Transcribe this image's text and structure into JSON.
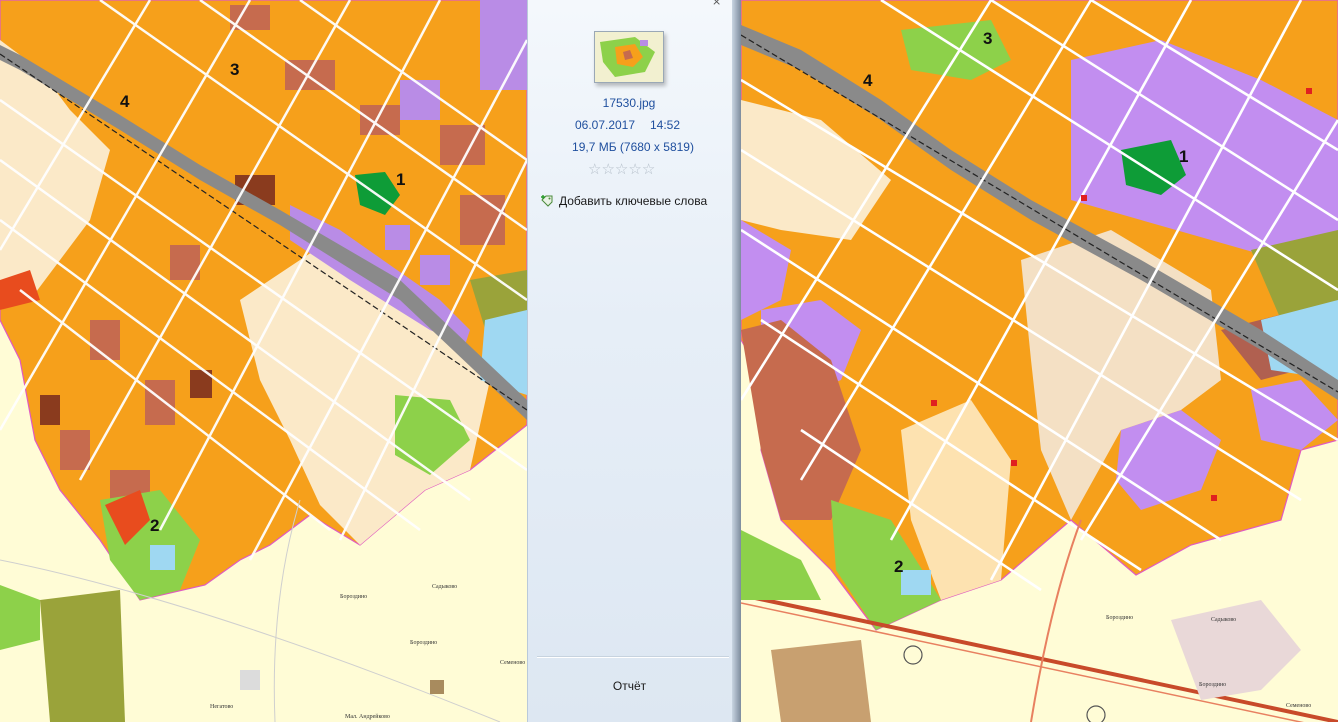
{
  "file": {
    "name": "17530.jpg",
    "date": "06.07.2017",
    "time": "14:52",
    "size": "19,7 МБ (7680 x 5819)"
  },
  "rating_stars": 5,
  "actions": {
    "add_tags": "Добавить ключевые слова",
    "report": "Отчёт"
  },
  "map_left": {
    "labels": [
      "1",
      "2",
      "3",
      "4"
    ],
    "places": [
      "Садыково",
      "Бороздино",
      "Бороздино",
      "Семеново",
      "Негатово",
      "Мал. Андрейково"
    ]
  },
  "map_right": {
    "labels": [
      "1",
      "2",
      "3",
      "4"
    ],
    "places": [
      "Бороздино",
      "Садыково",
      "Бороздино",
      "Семеново"
    ]
  },
  "colors": {
    "orange": "#f6a01b",
    "brown": "#c66b4e",
    "purple": "#b98ce6",
    "green": "#8dd14a",
    "cream": "#fbe9c8",
    "background": "#fffcd6"
  }
}
